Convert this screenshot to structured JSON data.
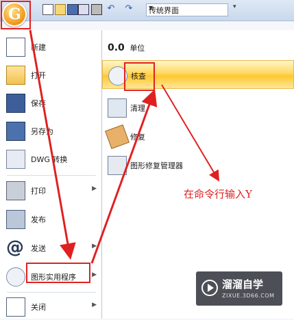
{
  "toolbar": {
    "workspace_value": "传统界面",
    "icons": [
      "app-menu-icon",
      "new-file-icon",
      "open-folder-icon",
      "save-icon",
      "edit-icon",
      "print-icon",
      "undo-icon",
      "redo-icon"
    ]
  },
  "left_menu": {
    "items": [
      {
        "label": "新建",
        "icon": "new-document-icon"
      },
      {
        "label": "打开",
        "icon": "open-folder-icon"
      },
      {
        "label": "保存",
        "icon": "save-disk-icon"
      },
      {
        "label": "另存为",
        "icon": "save-as-icon"
      },
      {
        "label": "DWG 转换",
        "icon": "dwg-convert-icon"
      },
      {
        "label": "打印",
        "icon": "printer-icon",
        "submenu": true
      },
      {
        "label": "发布",
        "icon": "publish-icon"
      },
      {
        "label": "发送",
        "icon": "at-send-icon",
        "submenu": true
      },
      {
        "label": "图形实用程序",
        "icon": "drawing-utilities-icon",
        "submenu": true
      },
      {
        "label": "关闭",
        "icon": "close-document-icon",
        "submenu": true
      }
    ]
  },
  "right_panel": {
    "units_value": "0.0",
    "units_label": "单位",
    "items": [
      {
        "label": "核查",
        "icon": "audit-magnifier-icon",
        "highlighted": true
      },
      {
        "label": "清理",
        "icon": "purge-brush-icon"
      },
      {
        "label": "修复",
        "icon": "recover-wrench-icon"
      },
      {
        "label": "图形修复管理器",
        "icon": "recovery-manager-icon"
      }
    ]
  },
  "annotation_text": "在命令行输入Y",
  "watermark": {
    "title": "溜溜自学",
    "url": "ZIXUE.3D66.COM"
  },
  "colors": {
    "highlight": "#ffd862",
    "annotation": "#e02020",
    "panel_border": "#b9c6d8"
  }
}
